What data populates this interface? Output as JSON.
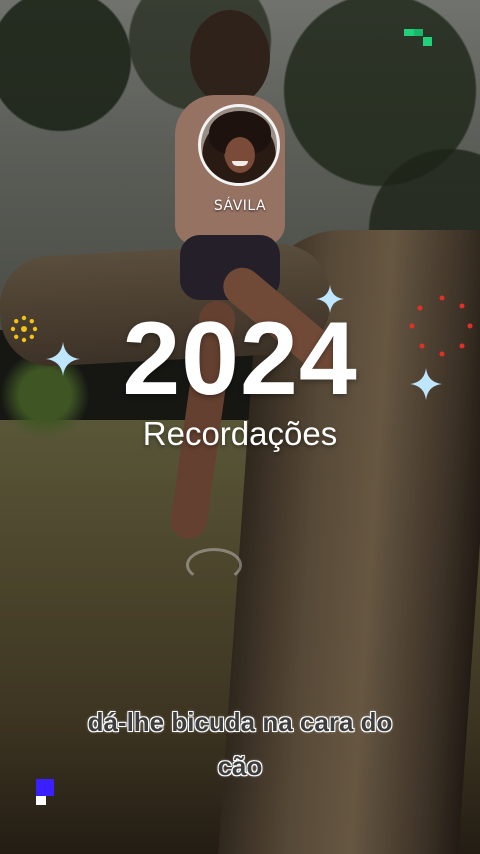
{
  "story": {
    "username": "SÁVILA",
    "year": "2024",
    "subtitle": "Recordações",
    "caption_line1": "dá-lhe bicuda na cara do",
    "caption_line2": "cão"
  },
  "icons": {
    "avatar": "profile-avatar-photo",
    "sparkles": [
      "four-point-star",
      "four-point-star",
      "four-point-star"
    ],
    "decorations": [
      "dotted-sun-circle",
      "red-dotted-ring",
      "green-pixels",
      "blue-pixel"
    ]
  },
  "colors": {
    "sparkle": "#bfe6ff",
    "sun_dots": "#f2c315",
    "red_dots": "#e0302a",
    "green_pixel": "#20d07a",
    "blue_pixel": "#3a1fff",
    "text": "#ffffff"
  }
}
